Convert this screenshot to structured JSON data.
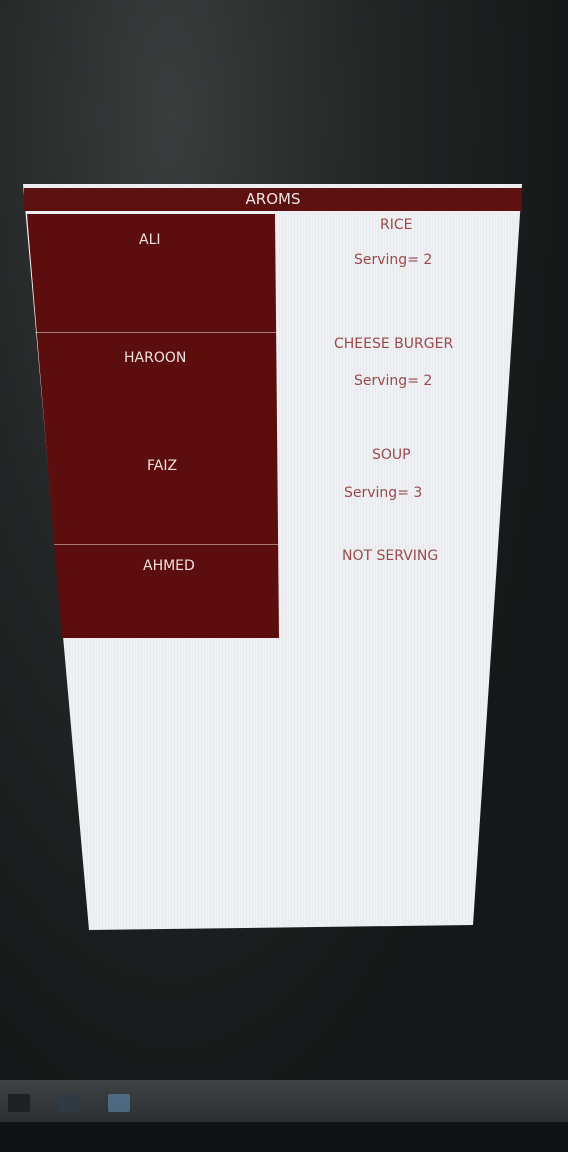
{
  "app": {
    "title": "AROMS"
  },
  "rows": [
    {
      "name": "ALI",
      "food": "RICE",
      "serving": "Serving= 2"
    },
    {
      "name": "HAROON",
      "food": "CHEESE BURGER",
      "serving": "Serving= 2"
    },
    {
      "name": "FAIZ",
      "food": "SOUP",
      "serving": "Serving= 3"
    },
    {
      "name": "AHMED",
      "food": "NOT SERVING",
      "serving": ""
    }
  ],
  "colors": {
    "title_bar": "#5c1010",
    "name_panel": "#5c0d0d",
    "food_text": "#9a4a4a",
    "screen_bg": "#eef0f3"
  }
}
